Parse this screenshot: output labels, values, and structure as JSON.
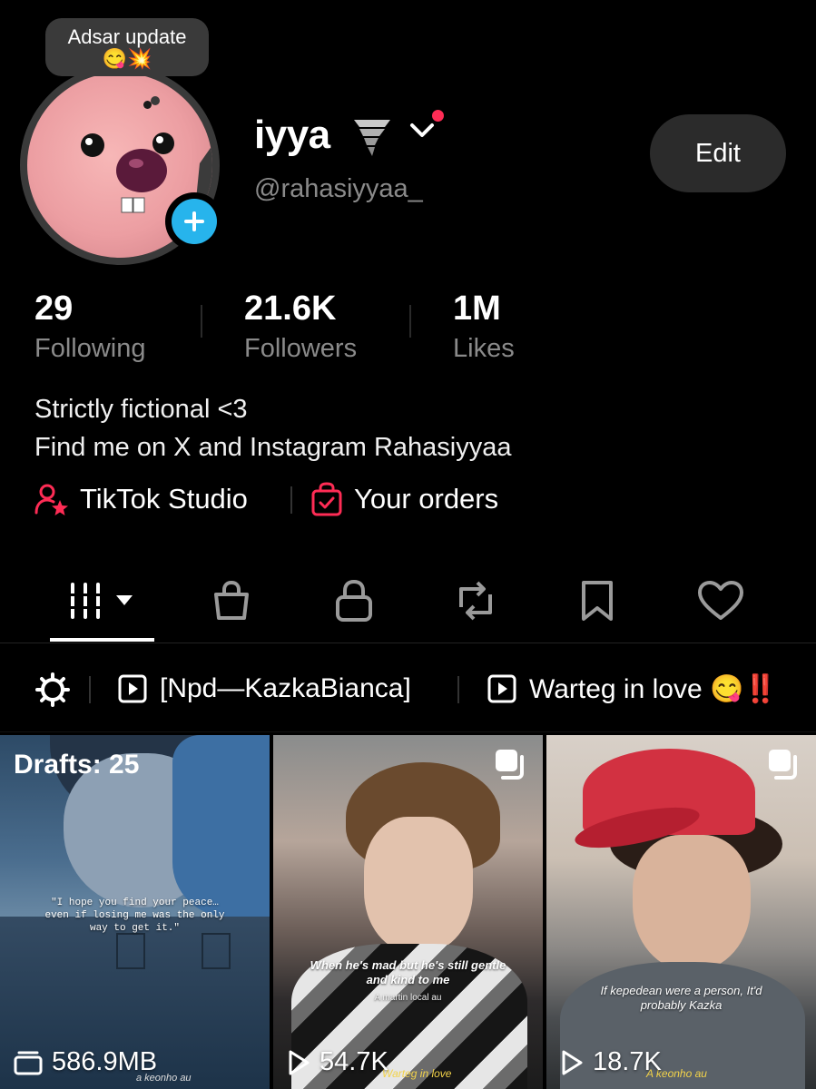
{
  "profile": {
    "note_text": "Adsar update",
    "note_emojis": "😋💥",
    "display_name": "iyya",
    "name_emoji": "🌪️",
    "username": "@rahasiyyaa_",
    "edit_label": "Edit"
  },
  "stats": [
    {
      "value": "29",
      "label": "Following"
    },
    {
      "value": "21.6K",
      "label": "Followers"
    },
    {
      "value": "1M",
      "label": "Likes"
    }
  ],
  "bio": {
    "line1": "Strictly fictional <3",
    "line2": "Find me on X and Instagram Rahasiyyaa"
  },
  "links": {
    "studio": "TikTok Studio",
    "orders": "Your orders"
  },
  "tabs": [
    {
      "name": "videos-tab",
      "icon": "grid-icon",
      "active": true
    },
    {
      "name": "shop-tab",
      "icon": "shopping-bag-icon"
    },
    {
      "name": "private-tab",
      "icon": "lock-icon"
    },
    {
      "name": "reposts-tab",
      "icon": "repost-icon"
    },
    {
      "name": "saved-tab",
      "icon": "bookmark-icon"
    },
    {
      "name": "liked-tab",
      "icon": "heart-icon"
    }
  ],
  "playlists": [
    {
      "label": "[Npd—KazkaBianca]"
    },
    {
      "label": "Warteg in love 😋‼️"
    }
  ],
  "grid": [
    {
      "drafts": "Drafts: 25",
      "caption": "\"I hope you find your peace… even if losing me was the only way to get it.\"",
      "stat": "586.9MB",
      "watermark": "a keonho au"
    },
    {
      "caption": "When he's mad but he's still gentle and kind to me",
      "sub_caption": "A martin local au",
      "stat": "54.7K",
      "watermark": "Warteg in love"
    },
    {
      "caption": "If kepedean were a person, It'd probably Kazka",
      "stat": "18.7K",
      "watermark": "A keonho au"
    }
  ],
  "colors": {
    "accent_red": "#fe2c55",
    "accent_blue": "#27b4ec",
    "muted_text": "#8a8a8a",
    "button_bg": "#2b2b2b"
  }
}
